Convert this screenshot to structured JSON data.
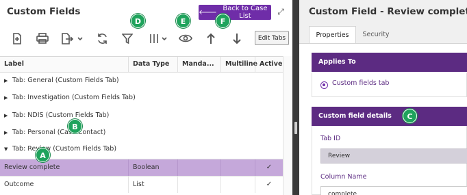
{
  "left": {
    "title": "Custom Fields",
    "back_button": "Back to Case List",
    "edit_tabs_label": "Edit Tabs",
    "columns": [
      "Label",
      "Data Type",
      "Manda...",
      "Multiline",
      "Active"
    ],
    "groups": [
      "Tab: General (Custom Fields Tab)",
      "Tab: Investigation (Custom Fields Tab)",
      "Tab: NDIS (Custom Fields Tab)",
      "Tab: Personal (Case Contact)",
      "Tab: Review (Custom Fields Tab)"
    ],
    "rows": [
      {
        "label": "Review complete",
        "data_type": "Boolean",
        "mandatory": "",
        "multiline": "",
        "active": "✓",
        "selected": true
      },
      {
        "label": "Outcome",
        "data_type": "List",
        "mandatory": "",
        "multiline": "",
        "active": "✓",
        "selected": false
      }
    ]
  },
  "right": {
    "title": "Custom Field - Review complete",
    "tabs": [
      "Properties",
      "Security"
    ],
    "applies_to": {
      "header": "Applies To",
      "option": "Custom fields tab"
    },
    "details": {
      "header": "Custom field details",
      "tab_id_label": "Tab ID",
      "tab_id_value": "Review",
      "column_name_label": "Column Name",
      "column_name_value": "complete"
    }
  },
  "markers": [
    "A",
    "B",
    "C",
    "D",
    "E",
    "F"
  ],
  "colors": {
    "accent": "#6f2da8",
    "section_header": "#5c2b82",
    "selected_row": "#c5a8da",
    "marker": "#1fa35c"
  },
  "icons": [
    "add-document-icon",
    "print-icon",
    "export-icon",
    "refresh-icon",
    "filter-icon",
    "columns-icon",
    "eye-icon",
    "arrow-up-icon",
    "arrow-down-icon",
    "expand-icon",
    "arrow-left-icon"
  ]
}
